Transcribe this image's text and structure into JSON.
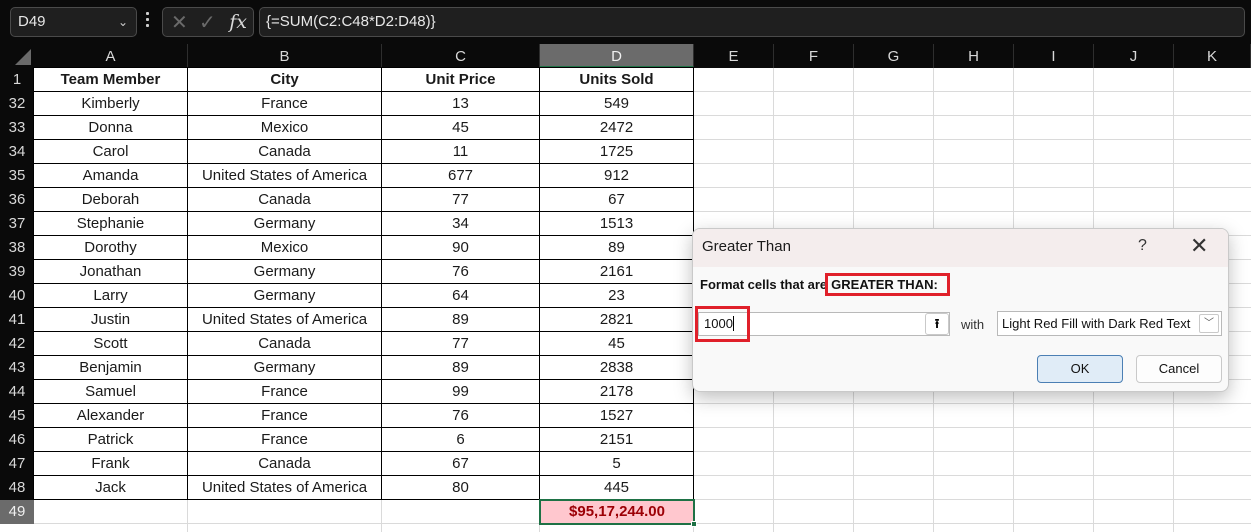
{
  "formula_bar": {
    "name_box": "D49",
    "cancel_icon": "✕",
    "enter_icon": "✓",
    "fx_label": "fx",
    "formula": "{=SUM(C2:C48*D2:D48)}"
  },
  "sheet": {
    "columns": [
      "A",
      "B",
      "C",
      "D",
      "E",
      "F",
      "G",
      "H",
      "I",
      "J",
      "K"
    ],
    "selected_column": "D",
    "selected_row": "49",
    "header_row_number": "1",
    "headers": [
      "Team Member",
      "City",
      "Unit Price",
      "Units Sold"
    ],
    "rows": [
      {
        "num": "32",
        "cells": [
          "Kimberly",
          "France",
          "13",
          "549"
        ]
      },
      {
        "num": "33",
        "cells": [
          "Donna",
          "Mexico",
          "45",
          "2472"
        ]
      },
      {
        "num": "34",
        "cells": [
          "Carol",
          "Canada",
          "11",
          "1725"
        ]
      },
      {
        "num": "35",
        "cells": [
          "Amanda",
          "United States of America",
          "677",
          "912"
        ]
      },
      {
        "num": "36",
        "cells": [
          "Deborah",
          "Canada",
          "77",
          "67"
        ]
      },
      {
        "num": "37",
        "cells": [
          "Stephanie",
          "Germany",
          "34",
          "1513"
        ]
      },
      {
        "num": "38",
        "cells": [
          "Dorothy",
          "Mexico",
          "90",
          "89"
        ]
      },
      {
        "num": "39",
        "cells": [
          "Jonathan",
          "Germany",
          "76",
          "2161"
        ]
      },
      {
        "num": "40",
        "cells": [
          "Larry",
          "Germany",
          "64",
          "23"
        ]
      },
      {
        "num": "41",
        "cells": [
          "Justin",
          "United States of America",
          "89",
          "2821"
        ]
      },
      {
        "num": "42",
        "cells": [
          "Scott",
          "Canada",
          "77",
          "45"
        ]
      },
      {
        "num": "43",
        "cells": [
          "Benjamin",
          "Germany",
          "89",
          "2838"
        ]
      },
      {
        "num": "44",
        "cells": [
          "Samuel",
          "France",
          "99",
          "2178"
        ]
      },
      {
        "num": "45",
        "cells": [
          "Alexander",
          "France",
          "76",
          "1527"
        ]
      },
      {
        "num": "46",
        "cells": [
          "Patrick",
          "France",
          "6",
          "2151"
        ]
      },
      {
        "num": "47",
        "cells": [
          "Frank",
          "Canada",
          "67",
          "5"
        ]
      },
      {
        "num": "48",
        "cells": [
          "Jack",
          "United States of America",
          "80",
          "445"
        ]
      }
    ],
    "total_row_number": "49",
    "total_value": "$95,17,244.00",
    "total_fill": "#ffc7ce",
    "total_text_color": "#9c0006"
  },
  "dialog": {
    "title": "Greater Than",
    "help_label": "?",
    "close_label": "✕",
    "prompt_prefix": "Format cells that are",
    "prompt_highlight": "GREATER THAN:",
    "value": "1000",
    "ref_button_icon": "⭱",
    "with_label": "with",
    "format_option": "Light Red Fill with Dark Red Text",
    "dropdown_icon": "﹀",
    "ok_label": "OK",
    "cancel_label": "Cancel",
    "annotation_color": "#e0202a"
  }
}
